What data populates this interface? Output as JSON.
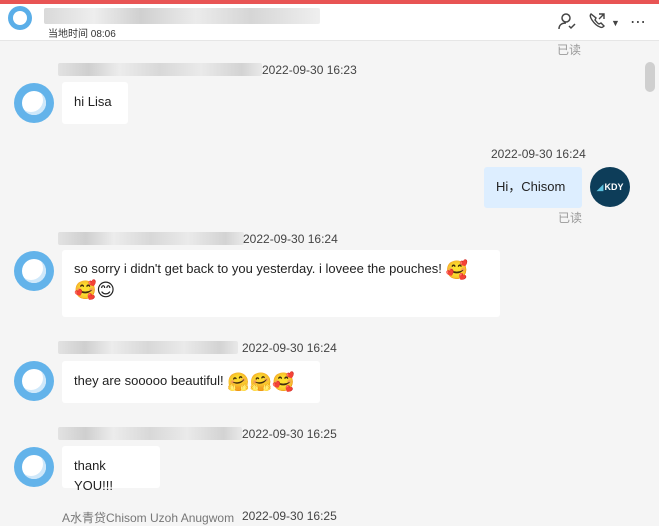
{
  "header": {
    "local_time": "当地时间 08:06",
    "icons": [
      "contact-icon",
      "phone-call-icon",
      "dropdown-icon",
      "more-icon"
    ]
  },
  "messages": [
    {
      "sender": "them",
      "time": "2022-09-30 16:23",
      "text": "hi Lisa"
    },
    {
      "sender": "me",
      "time": "2022-09-30 16:24",
      "text": "Hi，Chisom",
      "read": "已读"
    },
    {
      "sender": "them",
      "time": "2022-09-30 16:24",
      "text": "so sorry i didn't get back to you yesterday. i loveee the pouches!"
    },
    {
      "sender": "them",
      "time": "2022-09-30 16:24",
      "text": "they are sooooo beautiful!"
    },
    {
      "sender": "them",
      "time": "2022-09-30 16:25",
      "text": "thank YOU!!!"
    },
    {
      "sender": "them",
      "time": "2022-09-30 16:25",
      "name": "A水青贷Chisom Uzoh Anugwom"
    }
  ],
  "top_read": "已读",
  "my_avatar_label": "KDY",
  "emojis": {
    "smile_hearts": "🥰",
    "hugging": "🤗",
    "blush": "😊"
  }
}
